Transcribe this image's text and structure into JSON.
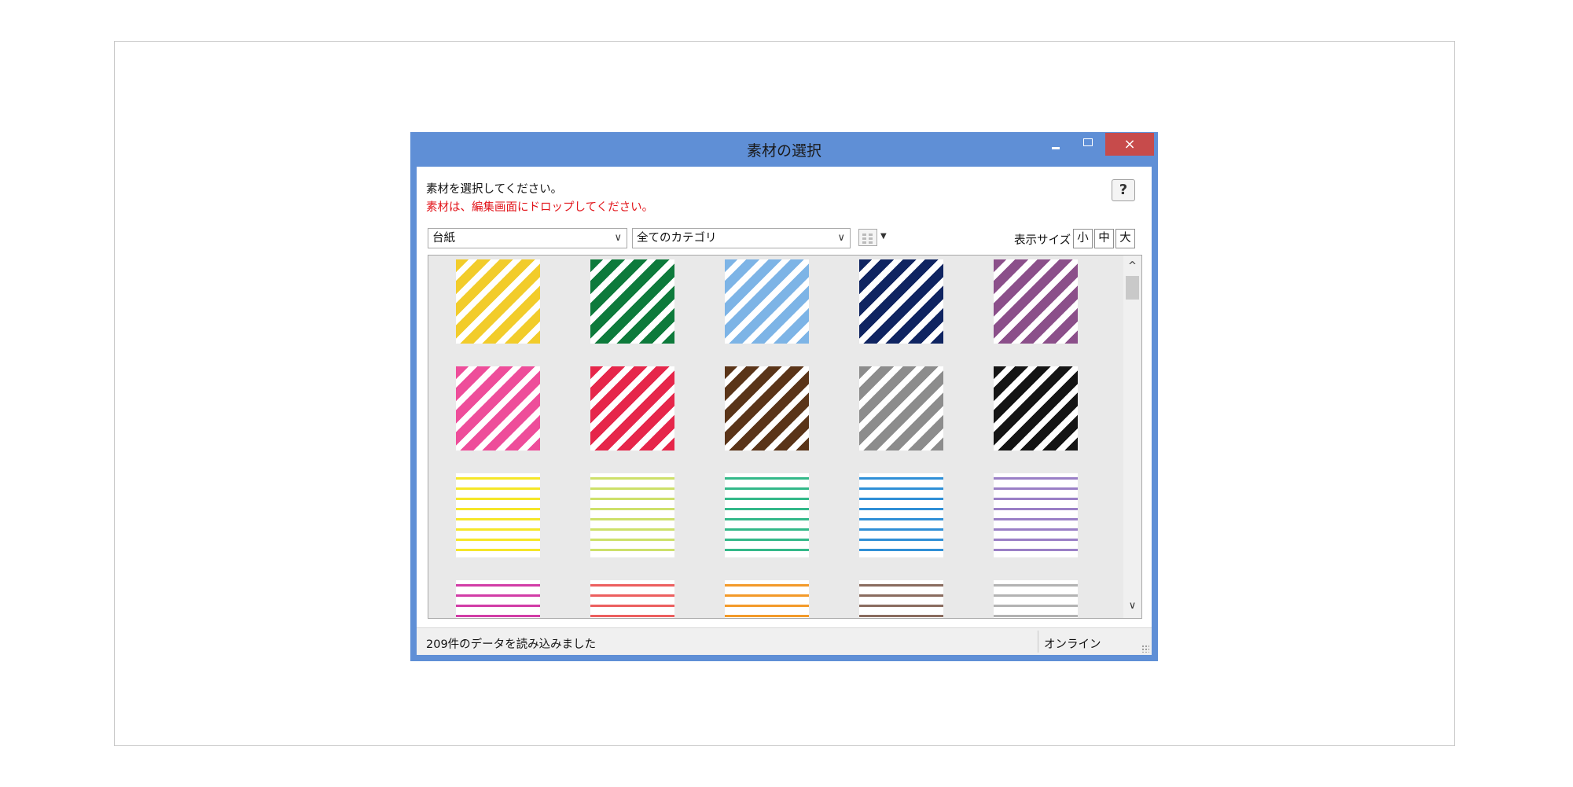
{
  "window": {
    "title": "素材の選択",
    "close_glyph": "×"
  },
  "instructions": {
    "line1": "素材を選択してください。",
    "line2": "素材は、編集画面にドロップしてください。"
  },
  "help_label": "?",
  "filters": {
    "type_select": "台紙",
    "category_select": "全てのカテゴリ",
    "arrow": "∨"
  },
  "size": {
    "label": "表示サイズ",
    "small": "小",
    "medium": "中",
    "large": "大"
  },
  "scroll": {
    "up": "^",
    "down": "∨"
  },
  "tiles": [
    {
      "name": "diagonal-stripe-yellow",
      "pattern": "diagonal",
      "color": "#f2cc2a"
    },
    {
      "name": "diagonal-stripe-green",
      "pattern": "diagonal",
      "color": "#0d7a3b"
    },
    {
      "name": "diagonal-stripe-light-blue",
      "pattern": "diagonal",
      "color": "#7db4e6"
    },
    {
      "name": "diagonal-stripe-navy",
      "pattern": "diagonal",
      "color": "#0f2461"
    },
    {
      "name": "diagonal-stripe-purple",
      "pattern": "diagonal",
      "color": "#8b4f8a"
    },
    {
      "name": "diagonal-stripe-pink",
      "pattern": "diagonal",
      "color": "#ee4d9a"
    },
    {
      "name": "diagonal-stripe-red",
      "pattern": "diagonal",
      "color": "#e6264a"
    },
    {
      "name": "diagonal-stripe-brown",
      "pattern": "diagonal",
      "color": "#5a3418"
    },
    {
      "name": "diagonal-stripe-gray",
      "pattern": "diagonal",
      "color": "#8c8c8c"
    },
    {
      "name": "diagonal-stripe-black",
      "pattern": "diagonal",
      "color": "#141414"
    },
    {
      "name": "horizontal-line-yellow",
      "pattern": "horizontal",
      "color": "#f5e628"
    },
    {
      "name": "horizontal-line-lime",
      "pattern": "horizontal",
      "color": "#cde06a"
    },
    {
      "name": "horizontal-line-teal",
      "pattern": "horizontal",
      "color": "#33b889"
    },
    {
      "name": "horizontal-line-blue",
      "pattern": "horizontal",
      "color": "#2f8fd6"
    },
    {
      "name": "horizontal-line-purple",
      "pattern": "horizontal",
      "color": "#9a7fc6"
    },
    {
      "name": "horizontal-line-magenta",
      "pattern": "horizontal",
      "color": "#d23da7"
    },
    {
      "name": "horizontal-line-red",
      "pattern": "horizontal",
      "color": "#ec5f5f"
    },
    {
      "name": "horizontal-line-orange",
      "pattern": "horizontal",
      "color": "#f39a2a"
    },
    {
      "name": "horizontal-line-brown",
      "pattern": "horizontal",
      "color": "#8a6c5f"
    },
    {
      "name": "horizontal-line-gray",
      "pattern": "horizontal",
      "color": "#b3b3b3"
    }
  ],
  "status": {
    "message": "209件のデータを読み込みました",
    "connection": "オンライン"
  }
}
